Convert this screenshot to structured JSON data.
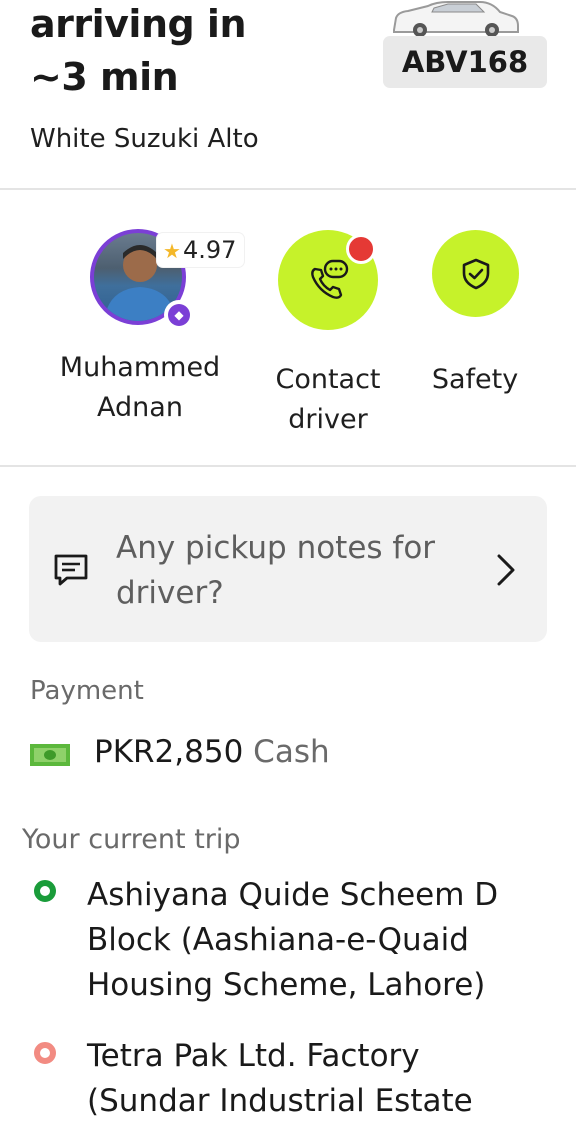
{
  "arrival": {
    "line1": "arriving in",
    "line2": "~3 min"
  },
  "vehicle": {
    "name": "White Suzuki Alto",
    "plate": "ABV168"
  },
  "driver": {
    "rating": "4.97",
    "first_name": "Muhammed",
    "last_name": "Adnan"
  },
  "actions": {
    "contact_line1": "Contact",
    "contact_line2": "driver",
    "safety": "Safety"
  },
  "pickup_notes": {
    "prompt_line1": "Any pickup notes for",
    "prompt_line2": "driver?"
  },
  "payment": {
    "label": "Payment",
    "amount": "PKR2,850",
    "method": "Cash"
  },
  "trip": {
    "label": "Your current trip",
    "pickup": {
      "line1": "Ashiyana Quide Scheem D",
      "line2": "Block (Aashiana-e-Quaid",
      "line3": "Housing Scheme, Lahore)"
    },
    "dropoff": {
      "line1": "Tetra Pak Ltd. Factory",
      "line2": "(Sundar Industrial Estate"
    }
  },
  "colors": {
    "accent_green": "#c6f22a",
    "avatar_ring": "#7b3fd6",
    "notification_red": "#e53935",
    "pickup_green": "#1a9c3a",
    "dropoff_pink": "#f28b82"
  },
  "icons": [
    "car-icon",
    "star-icon",
    "plus-badge-icon",
    "phone-chat-icon",
    "shield-check-icon",
    "message-icon",
    "chevron-right-icon",
    "cash-icon"
  ]
}
